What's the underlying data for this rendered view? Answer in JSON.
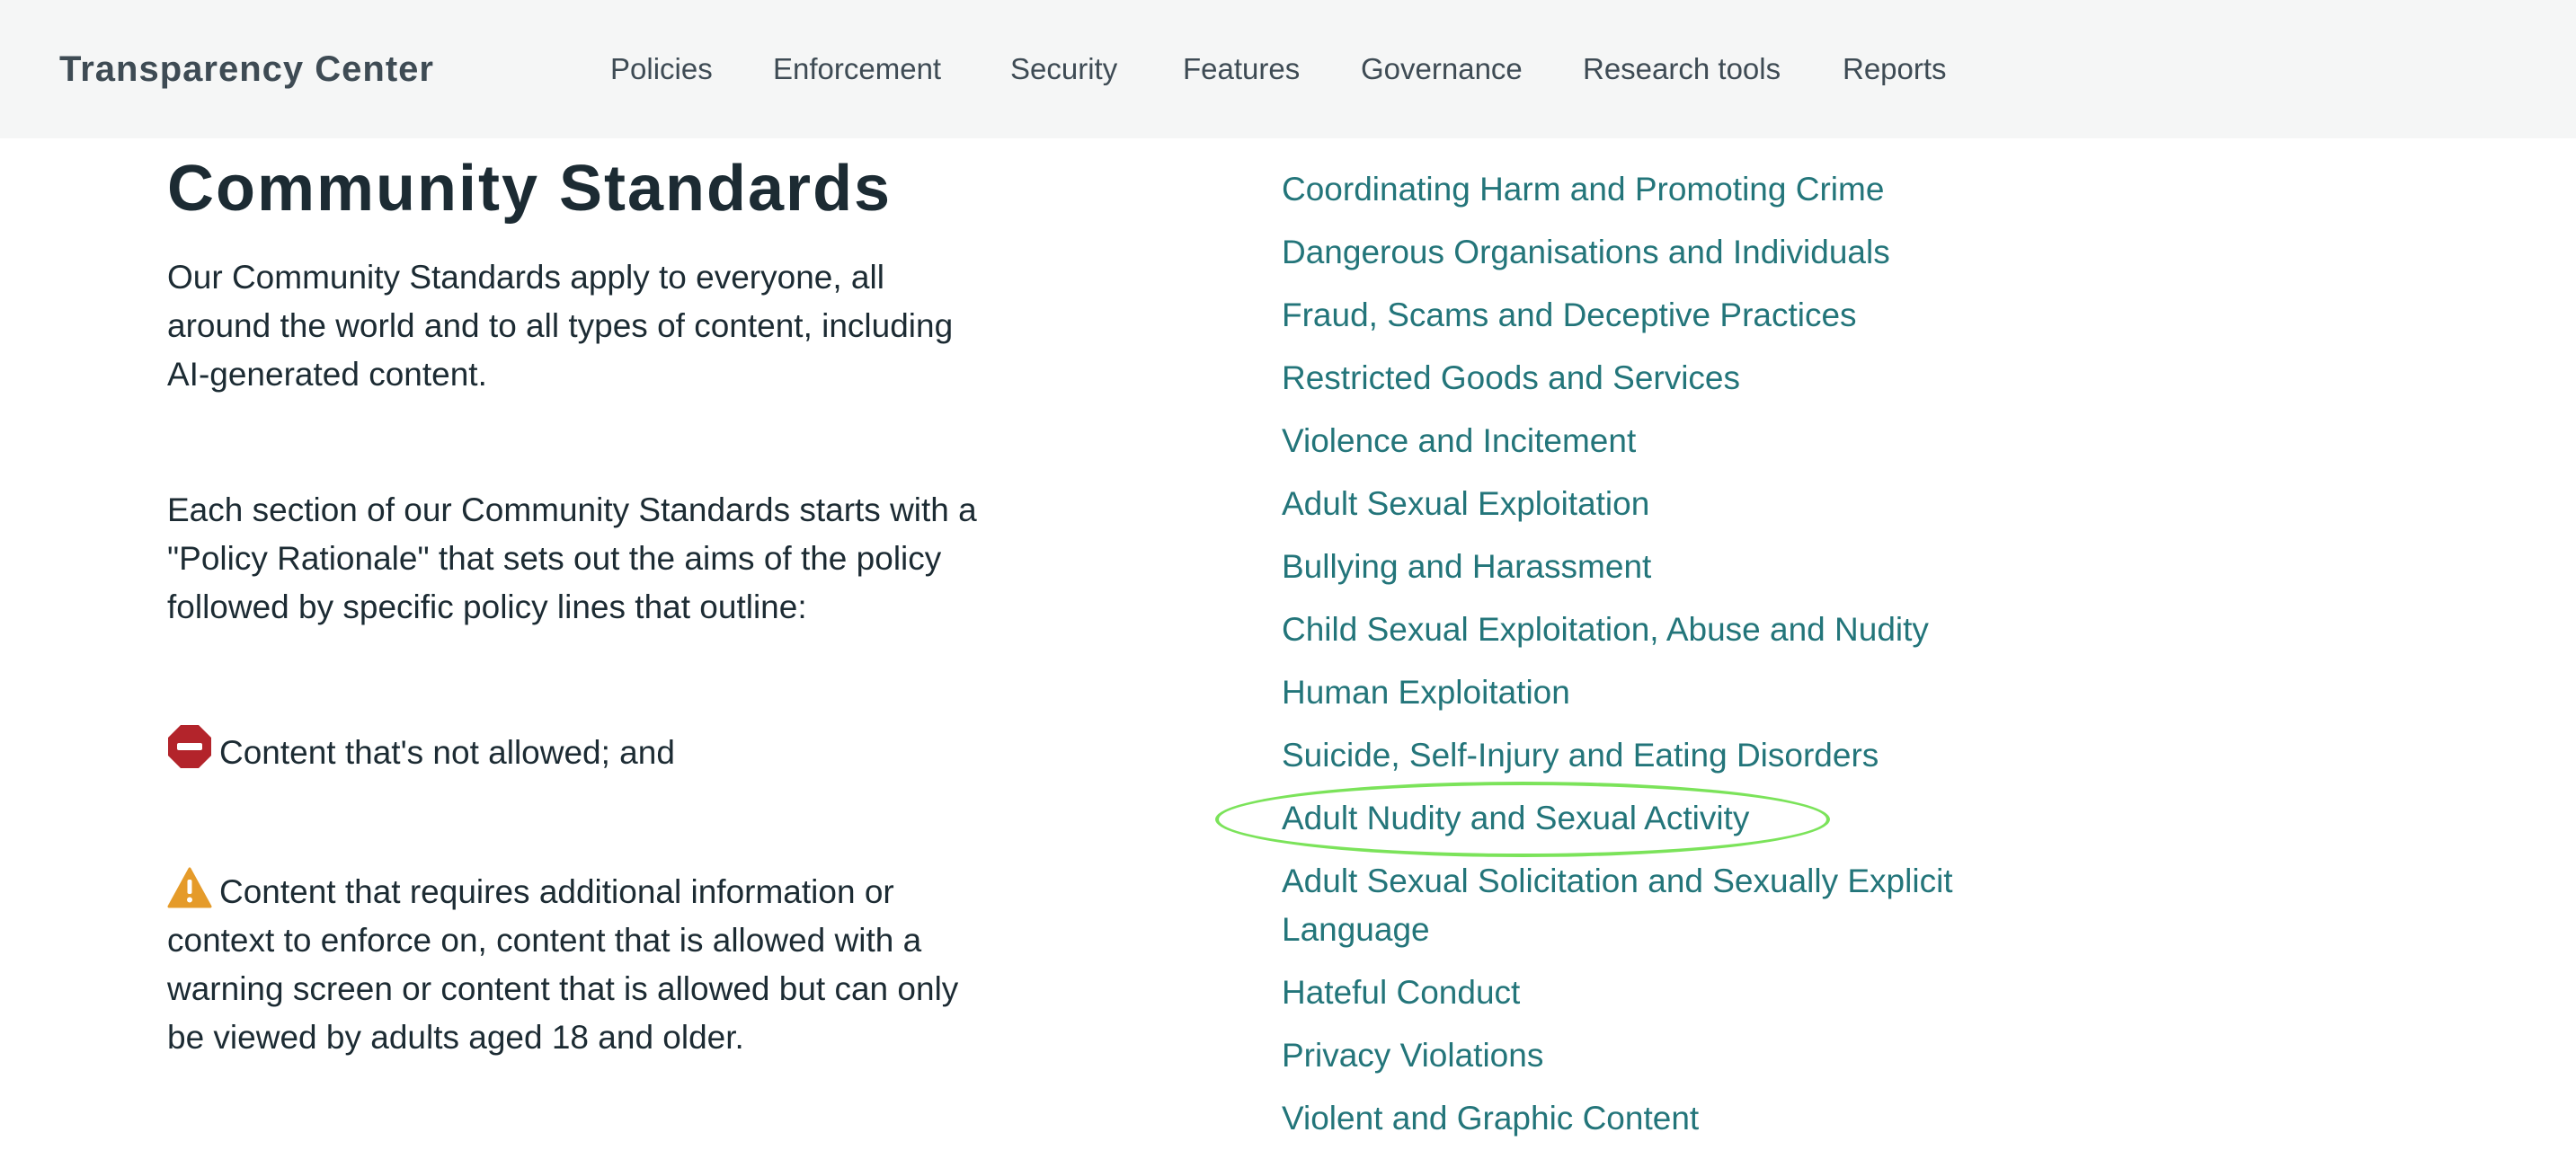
{
  "header": {
    "brand": "Transparency Center",
    "nav": [
      {
        "label": "Policies"
      },
      {
        "label": "Enforcement"
      },
      {
        "label": "Security"
      },
      {
        "label": "Features"
      },
      {
        "label": "Governance"
      },
      {
        "label": "Research tools"
      },
      {
        "label": "Reports"
      }
    ]
  },
  "intro": {
    "title": "Community Standards",
    "para1": "Our Community Standards apply to everyone, all around the world and to all types of content, including AI-generated content.",
    "para2": "Each section of our Community Standards starts with a \"Policy Rationale\" that sets out the aims of the policy followed by specific policy lines that outline:",
    "not_allowed": "Content that's not allowed; and",
    "context": "Content that requires additional information or context to enforce on, content that is allowed with a warning screen or content that is allowed but can only be viewed by adults aged 18 and older."
  },
  "icons": {
    "not_allowed": "no-entry-icon",
    "context": "warning-icon"
  },
  "colors": {
    "link": "#23757a",
    "stop_red": "#b3242b",
    "warning_orange": "#e59b2a",
    "highlight_green": "#7be35a"
  },
  "policies": [
    {
      "label": "Coordinating Harm and Promoting Crime"
    },
    {
      "label": "Dangerous Organisations and Individuals"
    },
    {
      "label": "Fraud, Scams and Deceptive Practices"
    },
    {
      "label": "Restricted Goods and Services"
    },
    {
      "label": "Violence and Incitement"
    },
    {
      "label": "Adult Sexual Exploitation"
    },
    {
      "label": "Bullying and Harassment"
    },
    {
      "label": "Child Sexual Exploitation, Abuse and Nudity"
    },
    {
      "label": "Human Exploitation"
    },
    {
      "label": "Suicide, Self-Injury and Eating Disorders"
    },
    {
      "label": "Adult Nudity and Sexual Activity",
      "highlighted": true
    },
    {
      "label": "Adult Sexual Solicitation and Sexually Explicit Language"
    },
    {
      "label": "Hateful Conduct"
    },
    {
      "label": "Privacy Violations"
    },
    {
      "label": "Violent and Graphic Content"
    }
  ]
}
